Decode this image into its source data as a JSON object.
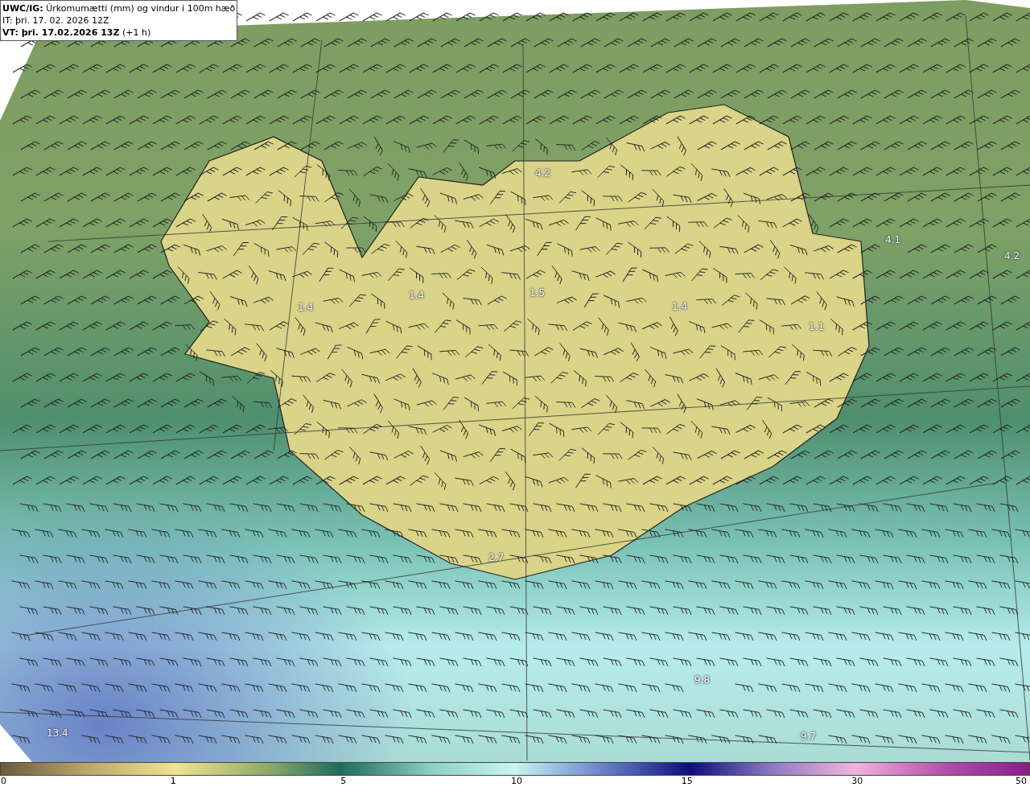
{
  "header": {
    "lines": [
      "**UWC/IG:** Úrkomumætti (mm) og vindur i 100m hæð",
      "IT: þri. 17. 02. 2026 12Z",
      "**VT: þri. 17.02.2026 13Z** (+1 h)"
    ]
  },
  "map_labels": [
    "4.2",
    "4.1",
    "4.2",
    "1.4",
    "1.4",
    "1.5",
    "1.4",
    "1.1",
    "2.7",
    "9.8",
    "13.4",
    "9.7"
  ],
  "legend": {
    "ticks": [
      "0",
      "1",
      "5",
      "10",
      "15",
      "30",
      "50"
    ]
  }
}
